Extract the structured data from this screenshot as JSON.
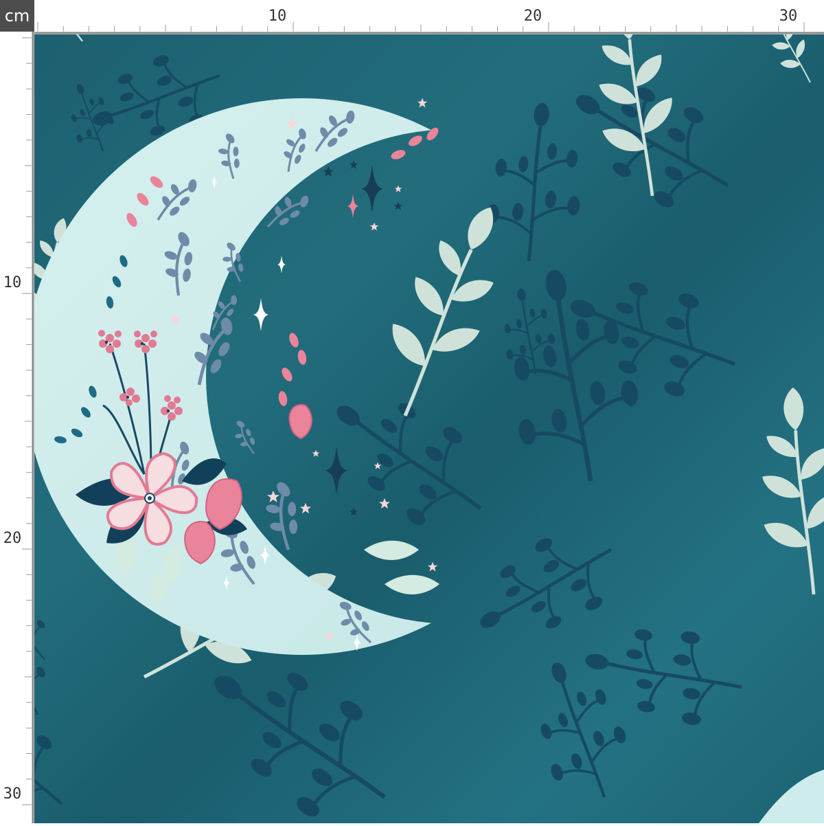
{
  "ruler": {
    "unit": "cm",
    "top_labels": [
      "10",
      "20",
      "30"
    ],
    "left_labels": [
      "10",
      "20",
      "30"
    ]
  },
  "palette": {
    "fabric": "#1f6777",
    "fabric_highlight": "#287b8b",
    "leaf_dark": "#164a63",
    "leaf_light": "#cfe2d9",
    "moon": "#cdeceb",
    "moon_motif": "#6e8ba8",
    "pink": "#e9849a",
    "pink_pale": "#f7d6da",
    "navy": "#163e56"
  }
}
